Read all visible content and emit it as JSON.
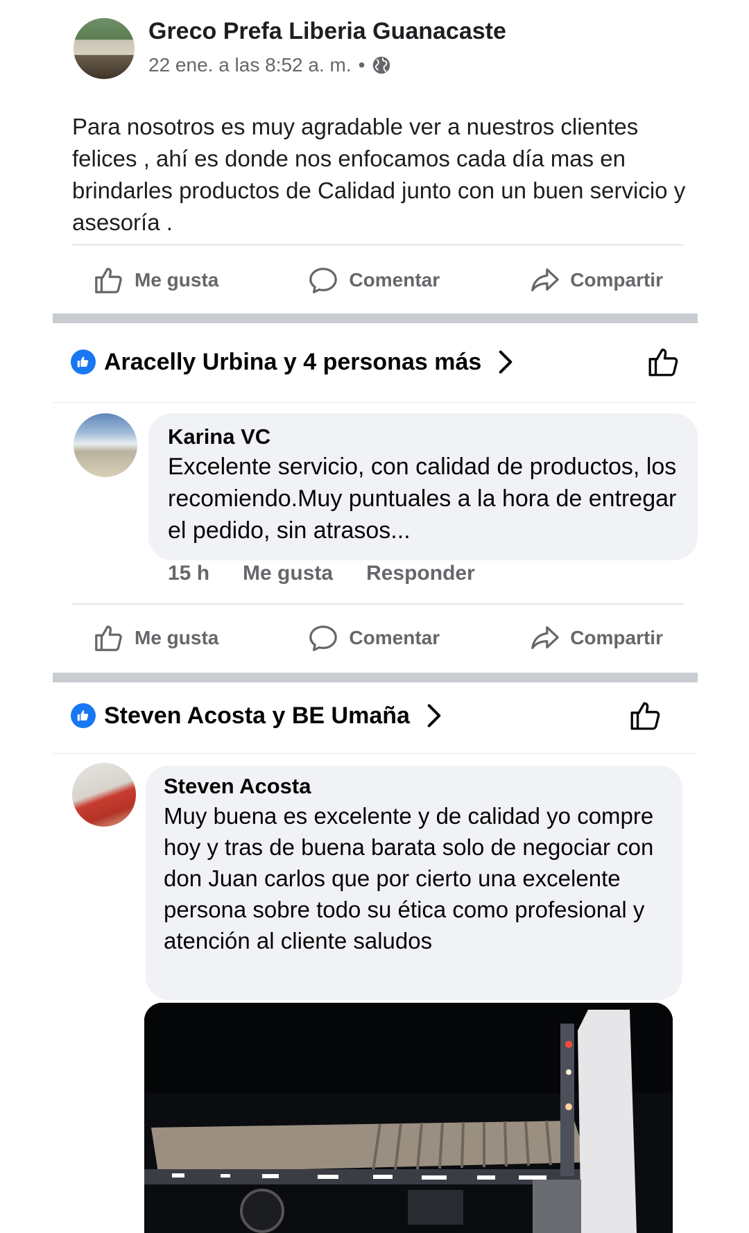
{
  "post": {
    "page_name": "Greco Prefa Liberia Guanacaste",
    "timestamp": "22 ene. a las 8:52 a. m.",
    "separator": "•",
    "privacy_icon": "globe-icon",
    "text": "Para nosotros es muy agradable ver a nuestros clientes felices , ahí es donde nos enfocamos cada día mas en brindarles productos de Calidad junto con un buen servicio y asesoría ."
  },
  "actions": {
    "like": "Me gusta",
    "comment": "Comentar",
    "share": "Compartir"
  },
  "sections": [
    {
      "likes_summary": "Aracelly Urbina y 4 personas más",
      "comment": {
        "author": "Karina VC",
        "text": "Excelente servicio, con calidad de productos, los recomiendo.Muy puntuales a la hora de entregar el pedido, sin atrasos..."
      },
      "meta": {
        "time": "15 h",
        "like": "Me gusta",
        "reply": "Responder"
      }
    },
    {
      "likes_summary": "Steven Acosta y BE Umaña",
      "comment": {
        "author": "Steven Acosta",
        "text": "Muy buena es excelente y de calidad yo compre hoy y tras de buena barata solo de negociar con don Juan carlos que por cierto una excelente persona sobre todo su ética como profesional y atención al cliente saludos"
      }
    }
  ],
  "colors": {
    "brand_blue": "#1877f2",
    "muted_text": "#65676b",
    "bubble_bg": "#f0f2f5",
    "section_gray": "#c9ccd1"
  }
}
